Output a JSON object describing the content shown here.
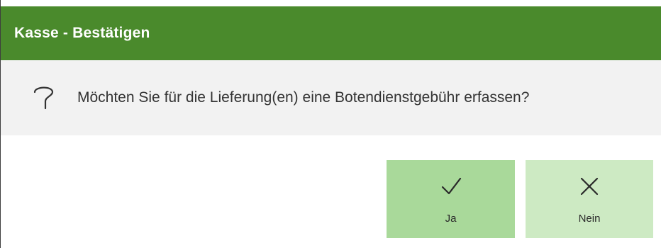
{
  "dialog": {
    "title": "Kasse - Bestätigen",
    "message": "Möchten Sie für die Lieferung(en) eine Botendienstgebühr erfassen?",
    "icon": "question-icon"
  },
  "buttons": {
    "yes": {
      "label": "Ja",
      "icon": "checkmark-icon"
    },
    "no": {
      "label": "Nein",
      "icon": "close-icon"
    }
  },
  "colors": {
    "title_bar": "#4a8a2c",
    "message_band": "#f2f2f2",
    "yes_button": "#a9d99a",
    "no_button": "#cdeac3"
  }
}
